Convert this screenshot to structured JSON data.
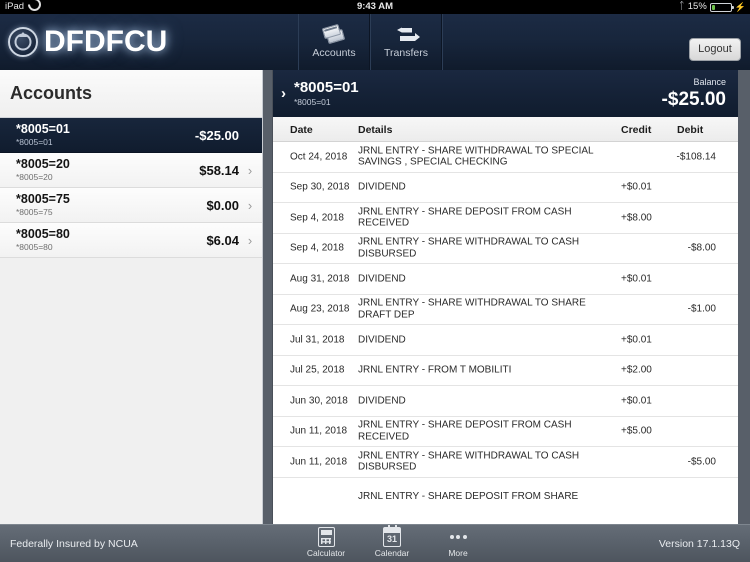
{
  "statusbar": {
    "device": "iPad",
    "wifi_icon": "wifi-icon",
    "time": "9:43 AM",
    "bluetooth_icon": "bluetooth-icon",
    "battery_percent": "15%",
    "battery_level": 15,
    "charging_icon": "lightning-bolt-icon"
  },
  "navbar": {
    "brand": "DFDFCU",
    "seal_icon": "credit-union-seal-icon",
    "tabs": [
      {
        "label": "Accounts",
        "icon": "credit-cards-icon"
      },
      {
        "label": "Transfers",
        "icon": "transfer-arrows-icon"
      }
    ],
    "logout_label": "Logout"
  },
  "sidebar": {
    "title": "Accounts",
    "accounts": [
      {
        "name": "*8005=01",
        "sub": "*8005=01",
        "balance": "-$25.00",
        "selected": true
      },
      {
        "name": "*8005=20",
        "sub": "*8005=20",
        "balance": "$58.14",
        "selected": false
      },
      {
        "name": "*8005=75",
        "sub": "*8005=75",
        "balance": "$0.00",
        "selected": false
      },
      {
        "name": "*8005=80",
        "sub": "*8005=80",
        "balance": "$6.04",
        "selected": false
      }
    ]
  },
  "detail": {
    "back_icon": "chevron-right-icon",
    "account_name": "*8005=01",
    "account_sub": "*8005=01",
    "balance_label": "Balance",
    "balance_value": "-$25.00",
    "columns": {
      "date": "Date",
      "details": "Details",
      "credit": "Credit",
      "debit": "Debit"
    },
    "transactions": [
      {
        "date": "Oct 24, 2018",
        "details": "JRNL ENTRY - SHARE WITHDRAWAL TO SPECIAL SAVINGS , SPECIAL CHECKING",
        "credit": "",
        "debit": "-$108.14"
      },
      {
        "date": "Sep 30, 2018",
        "details": "DIVIDEND",
        "credit": "+$0.01",
        "debit": ""
      },
      {
        "date": "Sep 4, 2018",
        "details": "JRNL ENTRY - SHARE DEPOSIT FROM CASH RECEIVED",
        "credit": "+$8.00",
        "debit": ""
      },
      {
        "date": "Sep 4, 2018",
        "details": "JRNL ENTRY - SHARE WITHDRAWAL TO CASH DISBURSED",
        "credit": "",
        "debit": "-$8.00"
      },
      {
        "date": "Aug 31, 2018",
        "details": "DIVIDEND",
        "credit": "+$0.01",
        "debit": ""
      },
      {
        "date": "Aug 23, 2018",
        "details": "JRNL ENTRY - SHARE WITHDRAWAL TO SHARE DRAFT DEP",
        "credit": "",
        "debit": "-$1.00"
      },
      {
        "date": "Jul 31, 2018",
        "details": "DIVIDEND",
        "credit": "+$0.01",
        "debit": ""
      },
      {
        "date": "Jul 25, 2018",
        "details": "JRNL ENTRY - FROM T MOBILITI",
        "credit": "+$2.00",
        "debit": ""
      },
      {
        "date": "Jun 30, 2018",
        "details": "DIVIDEND",
        "credit": "+$0.01",
        "debit": ""
      },
      {
        "date": "Jun 11, 2018",
        "details": "JRNL ENTRY - SHARE DEPOSIT FROM CASH RECEIVED",
        "credit": "+$5.00",
        "debit": ""
      },
      {
        "date": "Jun 11, 2018",
        "details": "JRNL ENTRY - SHARE WITHDRAWAL TO CASH DISBURSED",
        "credit": "",
        "debit": "-$5.00"
      },
      {
        "date": "",
        "details": "JRNL ENTRY - SHARE DEPOSIT FROM SHARE",
        "credit": "",
        "debit": ""
      }
    ]
  },
  "toolbar": {
    "insured_text": "Federally Insured by NCUA",
    "version_text": "Version 17.1.13Q",
    "items": [
      {
        "label": "Calculator",
        "icon": "calculator-icon"
      },
      {
        "label": "Calendar",
        "icon": "calendar-icon",
        "day": "31"
      },
      {
        "label": "More",
        "icon": "ellipsis-icon"
      }
    ]
  },
  "colors": {
    "navy": "#142134",
    "toolbar_gray": "#5a626c",
    "accent_green": "#6ec34a"
  }
}
